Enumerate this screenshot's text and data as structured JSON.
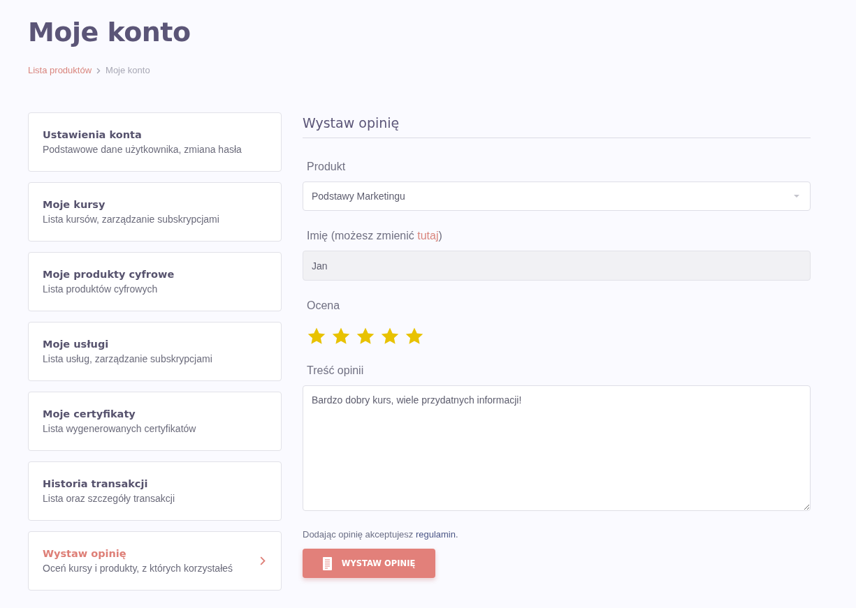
{
  "page": {
    "title": "Moje konto"
  },
  "breadcrumb": [
    {
      "label": "Lista produktów",
      "kind": "link"
    },
    {
      "label": "Moje konto",
      "kind": "current"
    }
  ],
  "sidebar": {
    "items": [
      {
        "title": "Ustawienia konta",
        "subtitle": "Podstawowe dane użytkownika, zmiana hasła",
        "selected": false
      },
      {
        "title": "Moje kursy",
        "subtitle": "Lista kursów, zarządzanie subskrypcjami",
        "selected": false
      },
      {
        "title": "Moje produkty cyfrowe",
        "subtitle": "Lista produktów cyfrowych",
        "selected": false
      },
      {
        "title": "Moje usługi",
        "subtitle": "Lista usług, zarządzanie subskrypcjami",
        "selected": false
      },
      {
        "title": "Moje certyfikaty",
        "subtitle": "Lista wygenerowanych certyfikatów",
        "selected": false
      },
      {
        "title": "Historia transakcji",
        "subtitle": "Lista oraz szczegóły transakcji",
        "selected": false
      },
      {
        "title": "Wystaw opinię",
        "subtitle": "Oceń kursy i produkty, z których korzystałeś",
        "selected": true
      }
    ]
  },
  "form": {
    "heading": "Wystaw opinię",
    "fields": [
      {
        "kind": "select",
        "label": "Produkt",
        "value": "Podstawy Marketingu"
      },
      {
        "kind": "input",
        "label": "Imię (możesz zmienić",
        "label_link": "tutaj",
        "label_end": ")",
        "value": "Jan",
        "disabled": true
      },
      {
        "kind": "rating",
        "label": "Ocena",
        "stars": 5
      },
      {
        "kind": "textarea",
        "label": "Treść opinii",
        "value": "Bardzo dobry kurs, wiele przydatnych informacji!"
      }
    ],
    "terms": {
      "text": "Dodając opinię akceptujesz",
      "link": "regulamin",
      "end": "."
    },
    "submit": {
      "label": "WYSTAW OPINIĘ"
    }
  }
}
